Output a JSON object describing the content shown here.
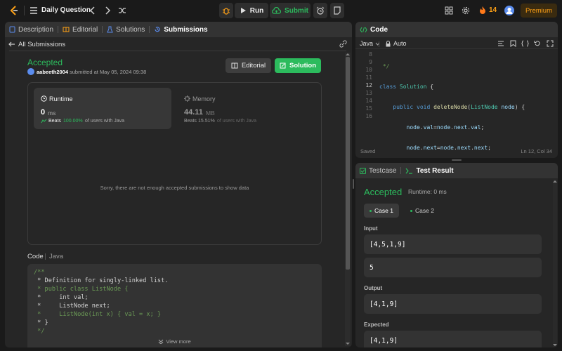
{
  "topbar": {
    "problem_list_label": "Daily Question",
    "run_label": "Run",
    "submit_label": "Submit",
    "streak_count": "14",
    "premium_label": "Premium"
  },
  "left": {
    "tabs": [
      {
        "label": "Description"
      },
      {
        "label": "Editorial"
      },
      {
        "label": "Solutions"
      },
      {
        "label": "Submissions"
      }
    ],
    "back_label": "All Submissions",
    "status": "Accepted",
    "status_color": "#2cbb5d",
    "username": "aabeeth2004",
    "submitted_text": "submitted at May 05, 2024 09:38",
    "editorial_button": "Editorial",
    "solution_button": "Solution",
    "runtime": {
      "title": "Runtime",
      "value": "0",
      "unit": "ms",
      "beats_prefix": "Beats",
      "beats_value": "100.00%",
      "beats_suffix": "of users with Java"
    },
    "memory": {
      "title": "Memory",
      "value": "44.11",
      "unit": "MB",
      "beats_prefix": "Beats",
      "beats_value": "15.51%",
      "beats_suffix": "of users with Java"
    },
    "chart_message": "Sorry, there are not enough accepted submissions to show data",
    "code_label": "Code",
    "code_lang": "Java",
    "code_lines": [
      "/**",
      " * Definition for singly-linked list.",
      " * public class ListNode {",
      " *     int val;",
      " *     ListNode next;",
      " *     ListNode(int x) { val = x; }",
      " * }",
      " */"
    ],
    "view_more": "View more"
  },
  "code_panel": {
    "title": "Code",
    "language": "Java",
    "autocomplete": "Auto",
    "line_numbers": [
      "8",
      "9",
      "10",
      "11",
      "12",
      "13",
      "14",
      "15",
      "16"
    ],
    "status": "Saved",
    "cursor": "Ln 12, Col 34"
  },
  "result_panel": {
    "tab_testcase": "Testcase",
    "tab_result": "Test Result",
    "status": "Accepted",
    "runtime_text": "Runtime: 0 ms",
    "cases": [
      "Case 1",
      "Case 2"
    ],
    "input_label": "Input",
    "input_values": [
      "[4,5,1,9]",
      "5"
    ],
    "output_label": "Output",
    "output_value": "[4,1,9]",
    "expected_label": "Expected",
    "expected_value": "[4,1,9]"
  }
}
